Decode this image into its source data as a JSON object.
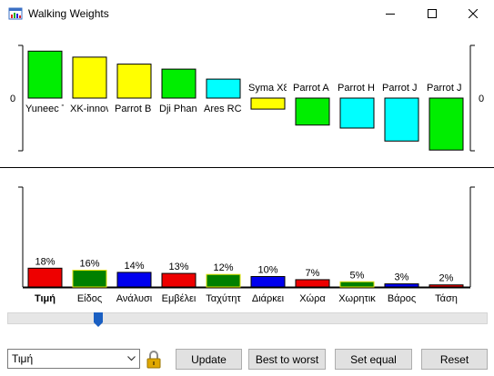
{
  "window": {
    "title": "Walking Weights",
    "controls": [
      "minimize-icon",
      "maximize-icon",
      "close-icon"
    ]
  },
  "colors": {
    "green": "#00ee00",
    "yellow": "#ffff00",
    "cyan": "#00ffff",
    "red": "#ee0000",
    "blue": "#0000ee",
    "darkgreen": "#008000",
    "slider_thumb": "#1a5fc2"
  },
  "chart_data": [
    {
      "type": "bar",
      "zero_label": "0",
      "categories": [
        "Yuneec Typhoon",
        "XK-innovations",
        "Parrot Bebop",
        "Dji Phantom",
        "Ares RC",
        "Syma X8",
        "Parrot AR",
        "Parrot Hydrofoil",
        "Parrot Jumping",
        "Parrot Jumping Sumo"
      ],
      "display_labels": [
        "Yuneec T",
        "XK-innov",
        "Parrot B",
        "Dji Phan",
        "Ares RC",
        "Syma X8",
        "Parrot A",
        "Parrot H",
        "Parrot J",
        "Parrot J"
      ],
      "values": [
        0.47,
        0.41,
        0.34,
        0.29,
        0.19,
        -0.11,
        -0.27,
        -0.3,
        -0.43,
        -0.52
      ],
      "colors": [
        "green",
        "yellow",
        "yellow",
        "green",
        "cyan",
        "yellow",
        "green",
        "cyan",
        "cyan",
        "green"
      ],
      "ylim": [
        -0.6,
        0.6
      ]
    },
    {
      "type": "bar",
      "categories": [
        "Τιμή",
        "Είδος",
        "Ανάλυσι",
        "Εμβέλει",
        "Ταχύτητ",
        "Διάρκει",
        "Χώρα",
        "Χωρητικ",
        "Βάρος",
        "Τάση"
      ],
      "values": [
        18,
        16,
        14,
        13,
        12,
        10,
        7,
        5,
        3,
        2
      ],
      "value_labels": [
        "18%",
        "16%",
        "14%",
        "13%",
        "12%",
        "10%",
        "7%",
        "5%",
        "3%",
        "2%"
      ],
      "colors": [
        "red",
        "darkgreen",
        "blue",
        "red",
        "darkgreen",
        "blue",
        "red",
        "darkgreen",
        "blue",
        "red"
      ],
      "highlight_border": "#e0e000",
      "selected_index": 0,
      "ylim": [
        0,
        100
      ]
    }
  ],
  "slider": {
    "value_fraction": 0.18
  },
  "controls": {
    "select_value": "Τιμή",
    "update_label": "Update",
    "best_label": "Best to worst",
    "equal_label": "Set equal",
    "reset_label": "Reset"
  }
}
